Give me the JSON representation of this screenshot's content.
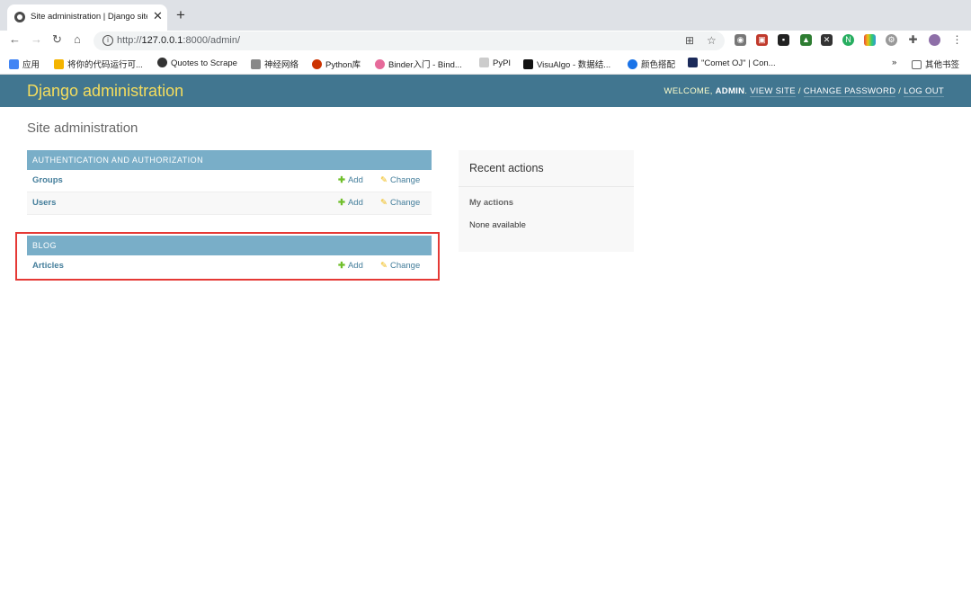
{
  "browser": {
    "tab_title": "Site administration | Django site admin",
    "tab_close": "✕",
    "new_tab": "+",
    "url_prefix": "http://",
    "url_host": "127.0.0.1",
    "url_path": ":8000/admin/",
    "bookmarks": [
      {
        "label": "应用",
        "color": "#4285f4"
      },
      {
        "label": "将你的代码运行可...",
        "color": "#f4b400"
      },
      {
        "label": "Quotes to Scrape",
        "color": "#333333"
      },
      {
        "label": "神经网络",
        "color": "#888888"
      },
      {
        "label": "Python库",
        "color": "#cc3300"
      },
      {
        "label": "Binder入门 - Bind...",
        "color": "#e66a9a"
      },
      {
        "label": "PyPI",
        "color": "#cccccc"
      },
      {
        "label": "VisuAlgo - 数据结...",
        "color": "#111111"
      },
      {
        "label": "颜色搭配",
        "color": "#1a73e8"
      },
      {
        "label": "\"Comet OJ\" | Con...",
        "color": "#1b2a5a"
      }
    ],
    "bookmarks_more": "»",
    "other_bookmarks": "其他书签"
  },
  "header": {
    "brand": "Django administration",
    "welcome": "WELCOME,",
    "user": "ADMIN",
    "view_site": "VIEW SITE",
    "change_password": "CHANGE PASSWORD",
    "log_out": "LOG OUT",
    "separator": "/"
  },
  "page": {
    "title": "Site administration"
  },
  "modules": {
    "auth": {
      "caption": "AUTHENTICATION AND AUTHORIZATION",
      "rows": [
        {
          "name": "Groups",
          "add": "Add",
          "change": "Change"
        },
        {
          "name": "Users",
          "add": "Add",
          "change": "Change"
        }
      ]
    },
    "blog": {
      "caption": "BLOG",
      "rows": [
        {
          "name": "Articles",
          "add": "Add",
          "change": "Change"
        }
      ]
    }
  },
  "recent": {
    "title": "Recent actions",
    "subtitle": "My actions",
    "empty": "None available"
  },
  "colors": {
    "header_bg": "#417690",
    "brand": "#f5dd5d",
    "caption_bg": "#79aec8",
    "link": "#447e9b",
    "add_icon": "#70bf2b",
    "change_icon": "#efb80b",
    "highlight": "#e53935"
  }
}
